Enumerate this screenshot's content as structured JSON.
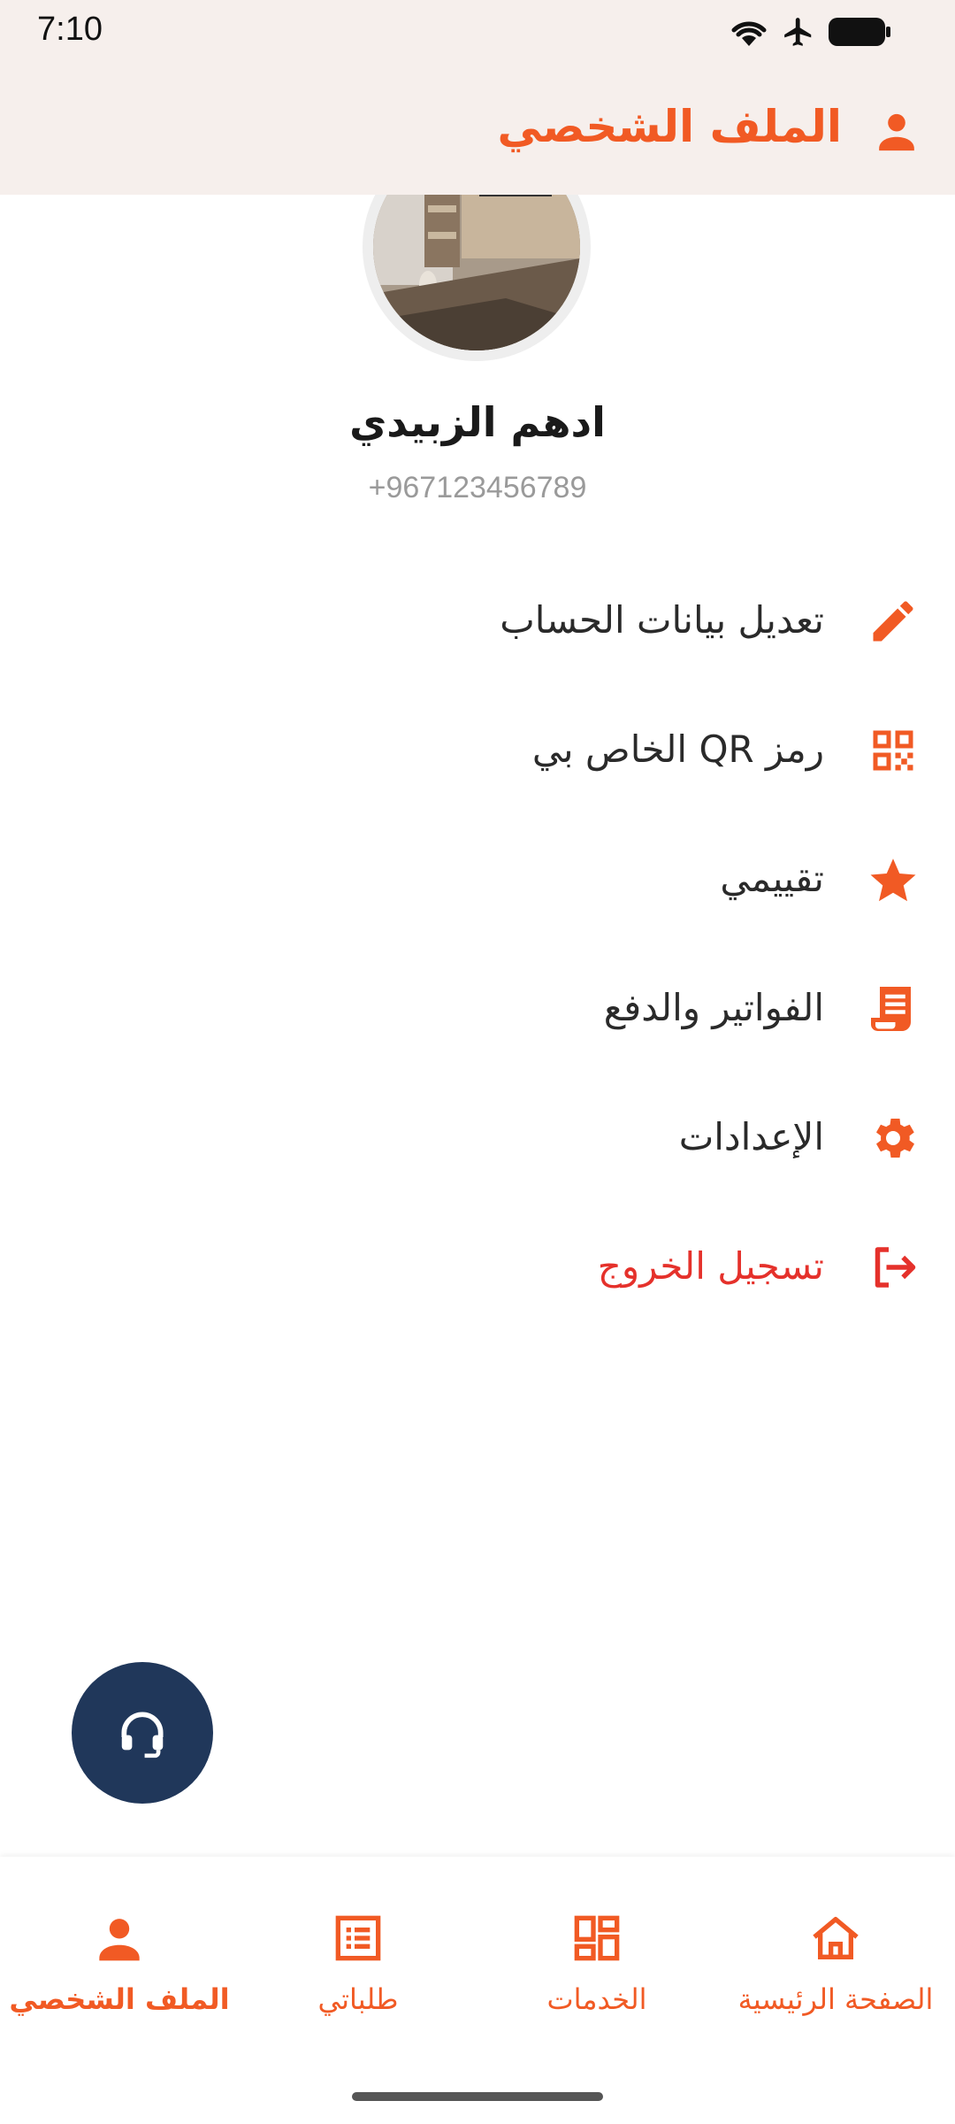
{
  "status_bar": {
    "time": "7:10",
    "icons": [
      "wifi-icon",
      "airplane-icon",
      "battery-icon"
    ]
  },
  "app_bar": {
    "title": "الملف الشخصي",
    "icon": "person-icon"
  },
  "profile": {
    "name": "ادهم الزبيدي",
    "phone": "+967123456789"
  },
  "menu": {
    "items": [
      {
        "label": "تعديل بيانات الحساب",
        "icon": "edit-icon"
      },
      {
        "label": "رمز QR الخاص بي",
        "icon": "qr-code-icon"
      },
      {
        "label": "تقييمي",
        "icon": "star-icon"
      },
      {
        "label": "الفواتير والدفع",
        "icon": "invoice-icon"
      },
      {
        "label": "الإعدادات",
        "icon": "gear-icon"
      },
      {
        "label": "تسجيل الخروج",
        "icon": "logout-icon"
      }
    ]
  },
  "support": {
    "icon": "headset-icon"
  },
  "bottom_nav": {
    "items": [
      {
        "label": "الصفحة الرئيسية",
        "icon": "home-icon"
      },
      {
        "label": "الخدمات",
        "icon": "services-icon"
      },
      {
        "label": "طلباتي",
        "icon": "orders-icon"
      },
      {
        "label": "الملف الشخصي",
        "icon": "person-icon",
        "active": true
      }
    ]
  },
  "colors": {
    "accent": "#f15a24",
    "logout": "#e5312b",
    "fab": "#20375a",
    "header_bg": "#f6efec"
  }
}
